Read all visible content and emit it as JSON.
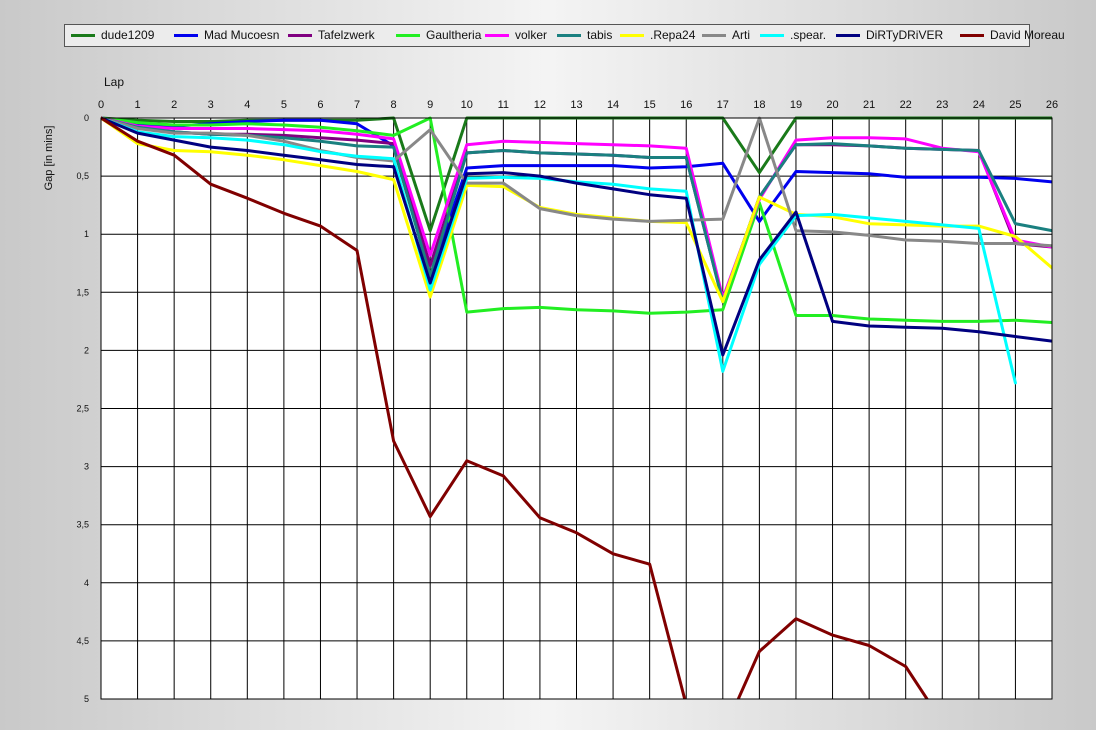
{
  "chart_data": {
    "type": "line",
    "xlabel": "Lap",
    "ylabel": "Gap [in mins]",
    "x": [
      0,
      1,
      2,
      3,
      4,
      5,
      6,
      7,
      8,
      9,
      10,
      11,
      12,
      13,
      14,
      15,
      16,
      17,
      18,
      19,
      20,
      21,
      22,
      23,
      24,
      25,
      26
    ],
    "x_tick_labels": [
      "0",
      "1",
      "2",
      "3",
      "4",
      "5",
      "6",
      "7",
      "8",
      "9",
      "10",
      "11",
      "12",
      "13",
      "14",
      "15",
      "16",
      "17",
      "18",
      "19",
      "20",
      "21",
      "22",
      "23",
      "24",
      "25",
      "26"
    ],
    "y_tick_labels": [
      "0",
      "0,5",
      "1",
      "1,5",
      "2",
      "2,5",
      "3",
      "3,5",
      "4",
      "4,5",
      "5"
    ],
    "y_ticks": [
      0,
      0.5,
      1,
      1.5,
      2,
      2.5,
      3,
      3.5,
      4,
      4.5,
      5
    ],
    "xlim": [
      0,
      26
    ],
    "ylim": [
      0,
      5
    ],
    "y_inverted": true,
    "grid": true,
    "legend_position": "top",
    "series": [
      {
        "name": "dude1209",
        "color": "#1a7a1a",
        "values": [
          0,
          0.02,
          0.03,
          0.03,
          0.02,
          0.02,
          0.02,
          0.02,
          0,
          0.97,
          0,
          0,
          0,
          0,
          0,
          0,
          0,
          0,
          0.47,
          0,
          0,
          0,
          0,
          0,
          0,
          0,
          0
        ]
      },
      {
        "name": "Mad Mucoesn",
        "color": "#0000ee",
        "values": [
          0,
          0.05,
          0.07,
          0.05,
          0.03,
          0.02,
          0.02,
          0.05,
          0.24,
          1.36,
          0.43,
          0.41,
          0.41,
          0.41,
          0.41,
          0.43,
          0.42,
          0.39,
          0.89,
          0.46,
          0.47,
          0.48,
          0.51,
          0.51,
          0.51,
          0.52,
          0.55
        ]
      },
      {
        "name": "Tafelzwerk",
        "color": "#800080",
        "values": [
          0,
          0.08,
          0.12,
          0.14,
          0.14,
          0.15,
          0.17,
          0.19,
          0.22,
          1.27,
          0.3,
          0.28,
          0.3,
          0.31,
          0.32,
          0.34,
          0.34,
          1.58,
          0.68,
          0.23,
          0.23,
          0.24,
          0.26,
          0.27,
          0.28,
          1.08,
          1.11
        ]
      },
      {
        "name": "Gaultheria",
        "color": "#22ee22",
        "values": [
          0,
          0.04,
          0.06,
          0.06,
          0.05,
          0.06,
          0.08,
          0.11,
          0.15,
          0,
          1.67,
          1.64,
          1.63,
          1.65,
          1.66,
          1.68,
          1.67,
          1.65,
          0.73,
          1.7,
          1.7,
          1.73,
          1.74,
          1.75,
          1.75,
          1.74,
          1.76
        ]
      },
      {
        "name": "volker",
        "color": "#ff00ff",
        "values": [
          0,
          0.07,
          0.09,
          0.09,
          0.09,
          0.1,
          0.11,
          0.14,
          0.18,
          1.18,
          0.23,
          0.2,
          0.21,
          0.22,
          0.23,
          0.24,
          0.26,
          1.55,
          0.7,
          0.19,
          0.17,
          0.17,
          0.18,
          0.26,
          0.29,
          1.05,
          1.11
        ]
      },
      {
        "name": "tabis",
        "color": "#1a8080",
        "values": [
          0,
          0.08,
          0.12,
          0.14,
          0.15,
          0.17,
          0.2,
          0.24,
          0.25,
          1.36,
          0.3,
          0.28,
          0.3,
          0.31,
          0.32,
          0.34,
          0.34,
          1.58,
          0.68,
          0.23,
          0.22,
          0.24,
          0.26,
          0.27,
          0.28,
          0.91,
          0.97
        ]
      },
      {
        "name": ".Repa24",
        "color": "#ffff00",
        "values": [
          0,
          0.22,
          0.28,
          0.29,
          0.32,
          0.36,
          0.41,
          0.46,
          0.53,
          1.54,
          0.58,
          0.59,
          0.77,
          0.83,
          0.86,
          0.89,
          0.9,
          1.58,
          0.68,
          0.83,
          0.85,
          0.91,
          0.92,
          0.93,
          0.93,
          1.02,
          1.29
        ]
      },
      {
        "name": "Arti",
        "color": "#888888",
        "values": [
          0,
          0.09,
          0.13,
          0.13,
          0.15,
          0.2,
          0.28,
          0.34,
          0.37,
          0.1,
          0.56,
          0.56,
          0.78,
          0.84,
          0.87,
          0.89,
          0.88,
          0.87,
          0,
          0.97,
          0.98,
          1.01,
          1.05,
          1.06,
          1.08,
          1.08,
          1.1
        ]
      },
      {
        "name": ".spear.",
        "color": "#00ffff",
        "values": [
          0,
          0.12,
          0.16,
          0.17,
          0.19,
          0.23,
          0.29,
          0.33,
          0.35,
          1.48,
          0.52,
          0.51,
          0.52,
          0.55,
          0.57,
          0.61,
          0.63,
          2.18,
          1.26,
          0.84,
          0.83,
          0.86,
          0.89,
          0.92,
          0.95,
          2.28,
          null
        ]
      },
      {
        "name": "DiRTyDRiVER",
        "color": "#000080",
        "values": [
          0,
          0.13,
          0.19,
          0.25,
          0.28,
          0.32,
          0.36,
          0.4,
          0.42,
          1.42,
          0.48,
          0.47,
          0.5,
          0.56,
          0.61,
          0.66,
          0.69,
          2.04,
          1.22,
          0.81,
          1.75,
          1.79,
          1.8,
          1.81,
          1.84,
          1.88,
          1.92
        ]
      },
      {
        "name": "David Moreau",
        "color": "#800000",
        "values": [
          0,
          0.2,
          0.32,
          0.57,
          0.69,
          0.82,
          0.93,
          1.14,
          2.78,
          3.43,
          2.95,
          3.08,
          3.44,
          3.57,
          3.75,
          3.84,
          5.05,
          5.3,
          4.59,
          4.31,
          4.45,
          4.54,
          4.72,
          5.2,
          5.3,
          5.3,
          5.3
        ]
      }
    ]
  }
}
